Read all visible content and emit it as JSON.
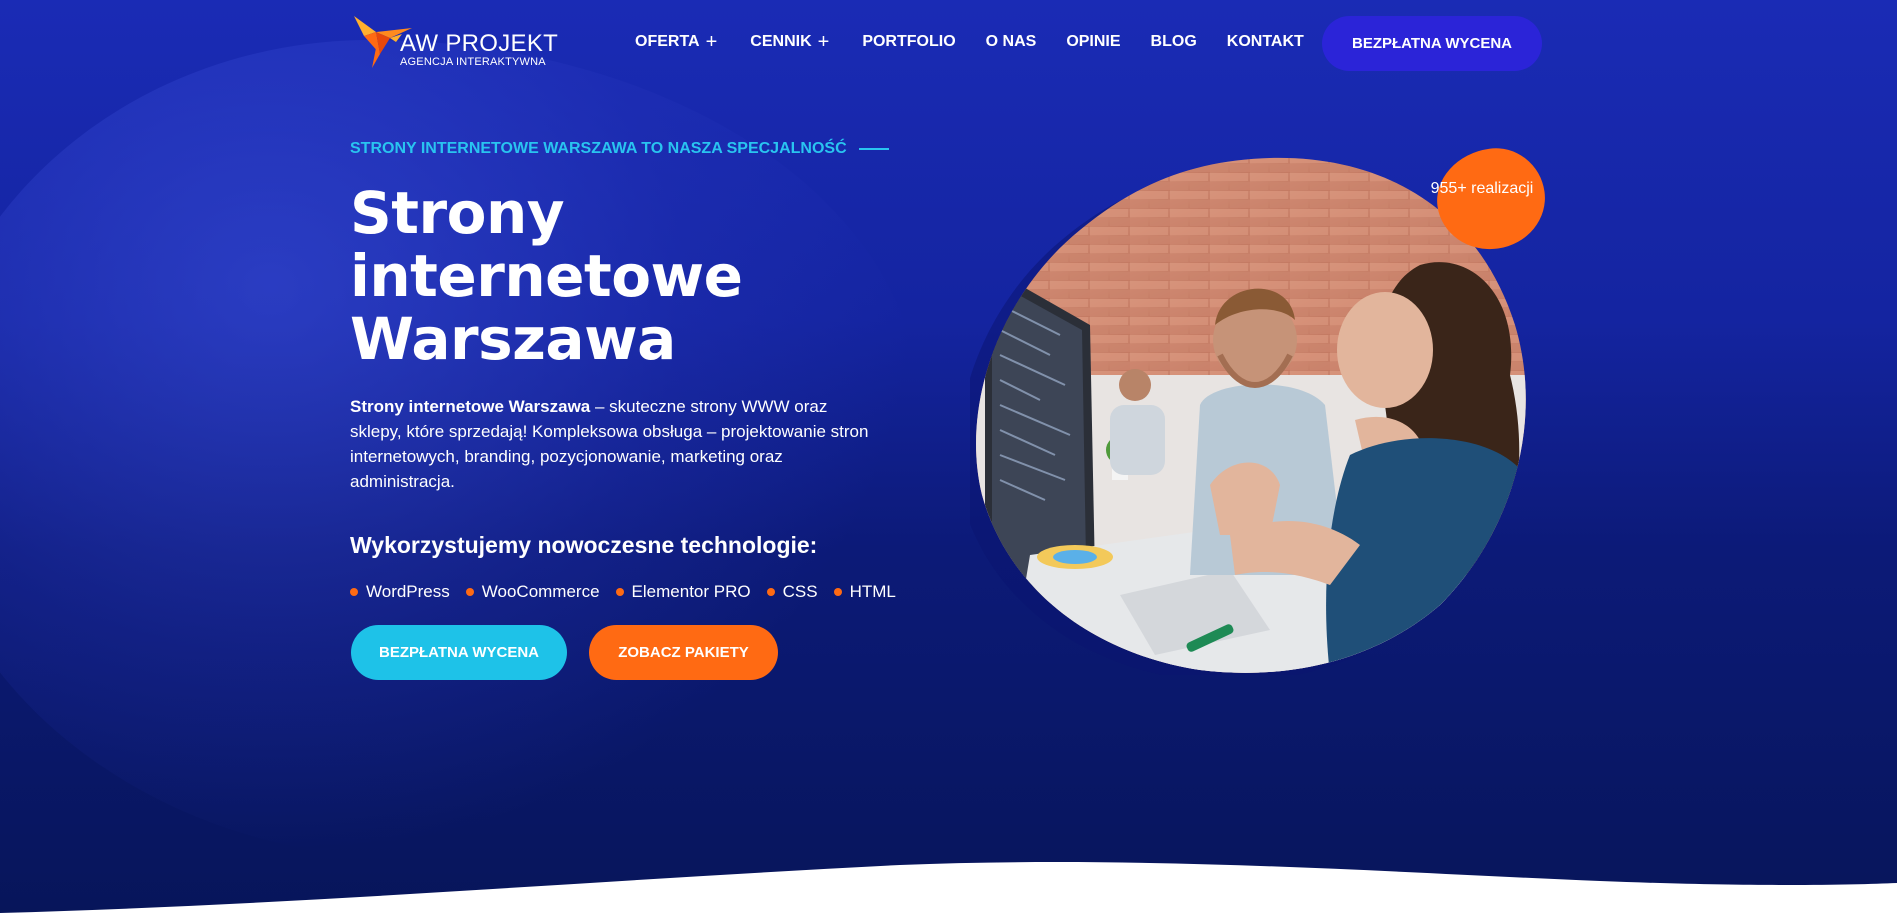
{
  "brand": {
    "name": "AW PROJEKT",
    "tagline": "AGENCJA INTERAKTYWNA",
    "logo_icon": "hummingbird-icon"
  },
  "nav": {
    "items": [
      {
        "label": "OFERTA",
        "has_plus": true
      },
      {
        "label": "CENNIK",
        "has_plus": true
      },
      {
        "label": "PORTFOLIO",
        "has_plus": false
      },
      {
        "label": "O NAS",
        "has_plus": false
      },
      {
        "label": "OPINIE",
        "has_plus": false
      },
      {
        "label": "BLOG",
        "has_plus": false
      },
      {
        "label": "KONTAKT",
        "has_plus": false
      }
    ],
    "plus_icon": "plus-icon",
    "cta_label": "BEZPŁATNA WYCENA"
  },
  "hero": {
    "eyebrow": "STRONY INTERNETOWE WARSZAWA TO NASZA SPECJALNOŚĆ",
    "title_lines": [
      "Strony",
      "internetowe",
      "Warszawa"
    ],
    "lead_bold": "Strony internetowe Warszawa",
    "lead_rest": " – skuteczne strony WWW oraz sklepy, które sprzedają! Kompleksowa obsługa – projektowanie stron internetowych, branding, pozycjonowanie, marketing oraz administracja.",
    "tech_title": "Wykorzystujemy nowoczesne technologie:",
    "tech": [
      "WordPress",
      "WooCommerce",
      "Elementor PRO",
      "CSS",
      "HTML"
    ],
    "btn_primary": "BEZPŁATNA WYCENA",
    "btn_secondary": "ZOBACZ PAKIETY",
    "badge": "955+ realizacji"
  },
  "colors": {
    "accent_orange": "#ff6a13",
    "accent_cyan": "#1ec2e8",
    "cta_blue": "#2b24d8",
    "bg_top": "#1a2bb5",
    "bg_bottom": "#07155a"
  }
}
